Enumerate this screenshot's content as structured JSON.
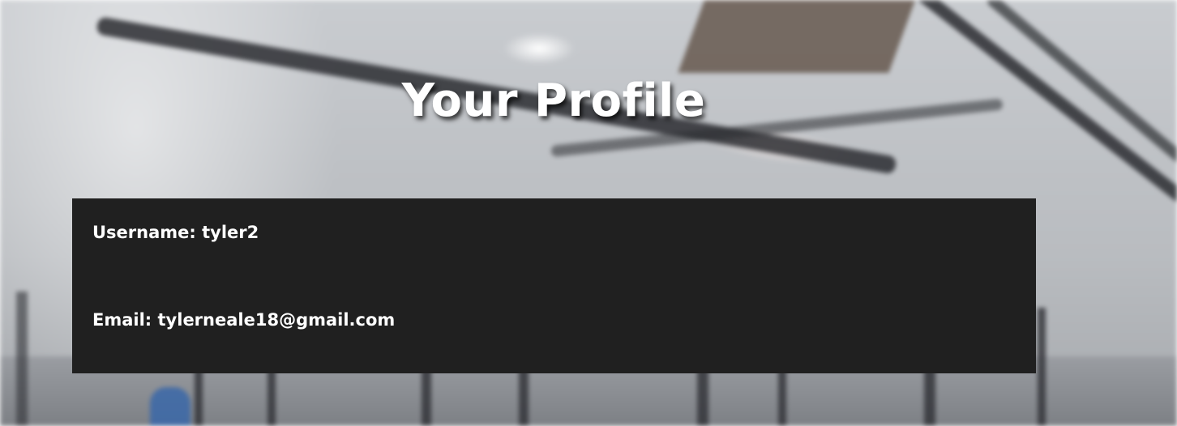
{
  "page": {
    "title": "Your Profile"
  },
  "profile": {
    "username_label": "Username:",
    "username_value": "tyler2",
    "email_label": "Email:",
    "email_value": "tylerneale18@gmail.com"
  },
  "colors": {
    "card_background": "#202020",
    "text": "#ffffff"
  }
}
